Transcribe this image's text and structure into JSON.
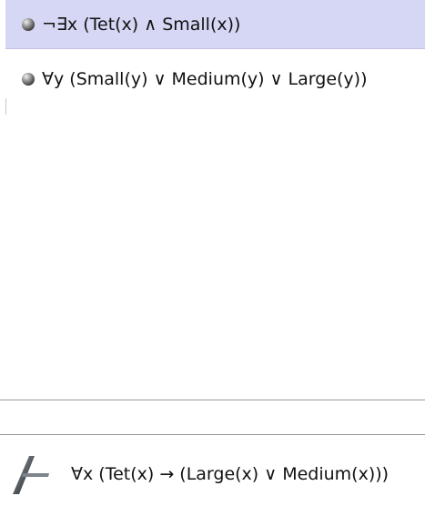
{
  "premises": [
    {
      "text": "¬∃x (Tet(x) ∧ Small(x))",
      "selected": true
    },
    {
      "text": "∀y (Small(y) ∨ Medium(y) ∨ Large(y))",
      "selected": false
    }
  ],
  "goal": {
    "text": "∀x (Tet(x) → (Large(x) ∨ Medium(x)))",
    "icon": "fitch-bar-icon"
  },
  "colors": {
    "selected_row": "#d6d6f5",
    "divider": "#9a9a9a"
  }
}
